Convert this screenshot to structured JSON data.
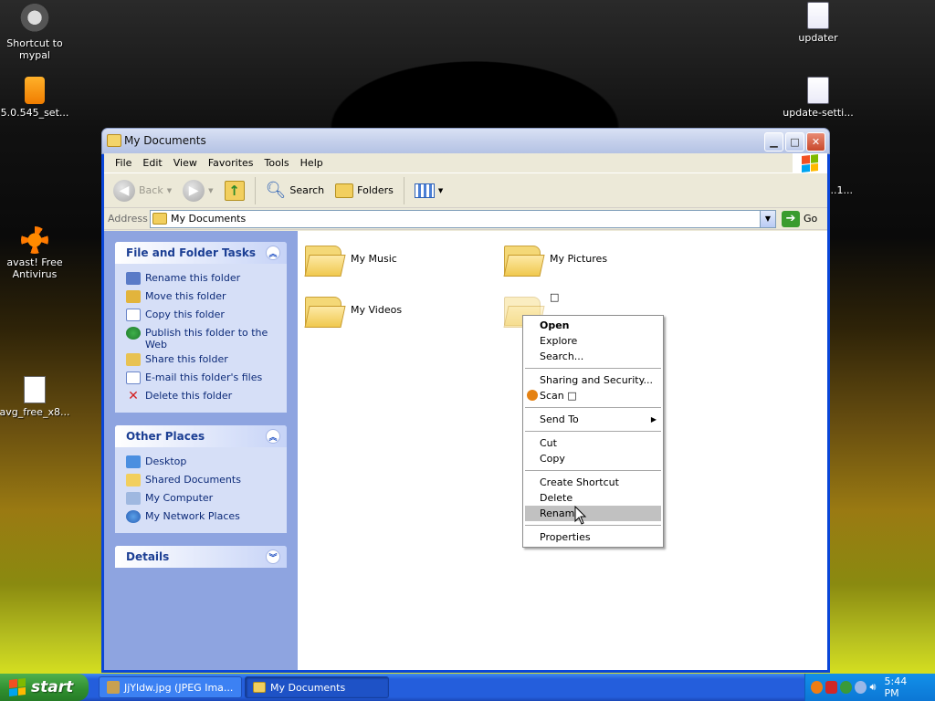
{
  "desktop": {
    "icons": [
      {
        "label": "Shortcut to mypal"
      },
      {
        "label": "5.0.545_set..."
      },
      {
        "label": "avast! Free Antivirus"
      },
      {
        "label": "avg_free_x8..."
      },
      {
        "label": "updater"
      },
      {
        "label": "update-setti..."
      },
      {
        "label": "...1..."
      }
    ]
  },
  "window": {
    "title": "My Documents",
    "menu": [
      "File",
      "Edit",
      "View",
      "Favorites",
      "Tools",
      "Help"
    ],
    "toolbar": {
      "back": "Back",
      "search": "Search",
      "folders": "Folders"
    },
    "address": {
      "label": "Address",
      "value": "My Documents",
      "go": "Go"
    }
  },
  "taskpane": {
    "file_tasks": {
      "title": "File and Folder Tasks",
      "items": [
        "Rename this folder",
        "Move this folder",
        "Copy this folder",
        "Publish this folder to the Web",
        "Share this folder",
        "E-mail this folder's files",
        "Delete this folder"
      ]
    },
    "other_places": {
      "title": "Other Places",
      "items": [
        "Desktop",
        "Shared Documents",
        "My Computer",
        "My Network Places"
      ]
    },
    "details": {
      "title": "Details"
    }
  },
  "folders": [
    {
      "name": "My Music"
    },
    {
      "name": "My Pictures"
    },
    {
      "name": "My Videos"
    },
    {
      "name": "□"
    }
  ],
  "context_menu": {
    "items": [
      "Open",
      "Explore",
      "Search...",
      "Sharing and Security...",
      "Scan □",
      "Send To",
      "Cut",
      "Copy",
      "Create Shortcut",
      "Delete",
      "Rename",
      "Properties"
    ]
  },
  "taskbar": {
    "start": "start",
    "tasks": [
      "JjYldw.jpg (JPEG Ima...",
      "My Documents"
    ],
    "clock": "5:44 PM"
  },
  "colors": {
    "taskbar_blue": "#245edc",
    "start_green": "#2f8e2f",
    "taskpane_blue": "#8ea4e0",
    "link_blue": "#0c2a78"
  }
}
